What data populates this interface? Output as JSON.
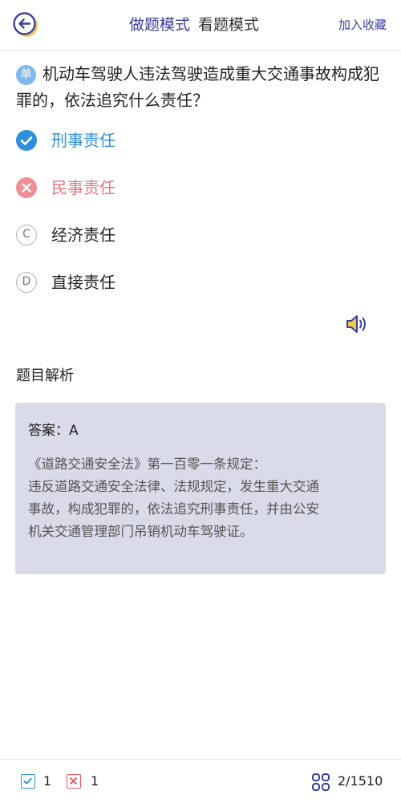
{
  "header": {
    "tab_practice": "做题模式",
    "tab_review": "看题模式",
    "favorite": "加入收藏"
  },
  "question": {
    "type_badge": "单",
    "text": "机动车驾驶人违法驾驶造成重大交通事故构成犯罪的，依法追究什么责任？"
  },
  "options": [
    {
      "letter": "A",
      "text": "刑事责任",
      "state": "correct"
    },
    {
      "letter": "B",
      "text": "民事责任",
      "state": "wrong"
    },
    {
      "letter": "C",
      "text": "经济责任",
      "state": "normal"
    },
    {
      "letter": "D",
      "text": "直接责任",
      "state": "normal"
    }
  ],
  "analysis": {
    "title": "题目解析",
    "answer": "答案：A",
    "lines": [
      "《道路交通安全法》第一百零一条规定：",
      "违反道路交通安全法律、法规规定，发生重大交通",
      "事故，构成犯罪的，依法追究刑事责任，并由公安",
      "机关交通管理部门吊销机动车驾驶证。"
    ]
  },
  "footer": {
    "correct_count": "1",
    "wrong_count": "1",
    "progress": "2/1510"
  },
  "colors": {
    "accent": "#3b3f9e",
    "correct": "#2f8fd8",
    "wrong": "#f08f97",
    "analysis_bg": "#d9dbe8",
    "back_icon_ring": "#f2c94c"
  },
  "icons": {
    "back": "back-arrow-icon",
    "correct": "check-icon",
    "wrong": "x-icon",
    "audio": "speaker-icon",
    "grid": "grid-menu-icon"
  }
}
